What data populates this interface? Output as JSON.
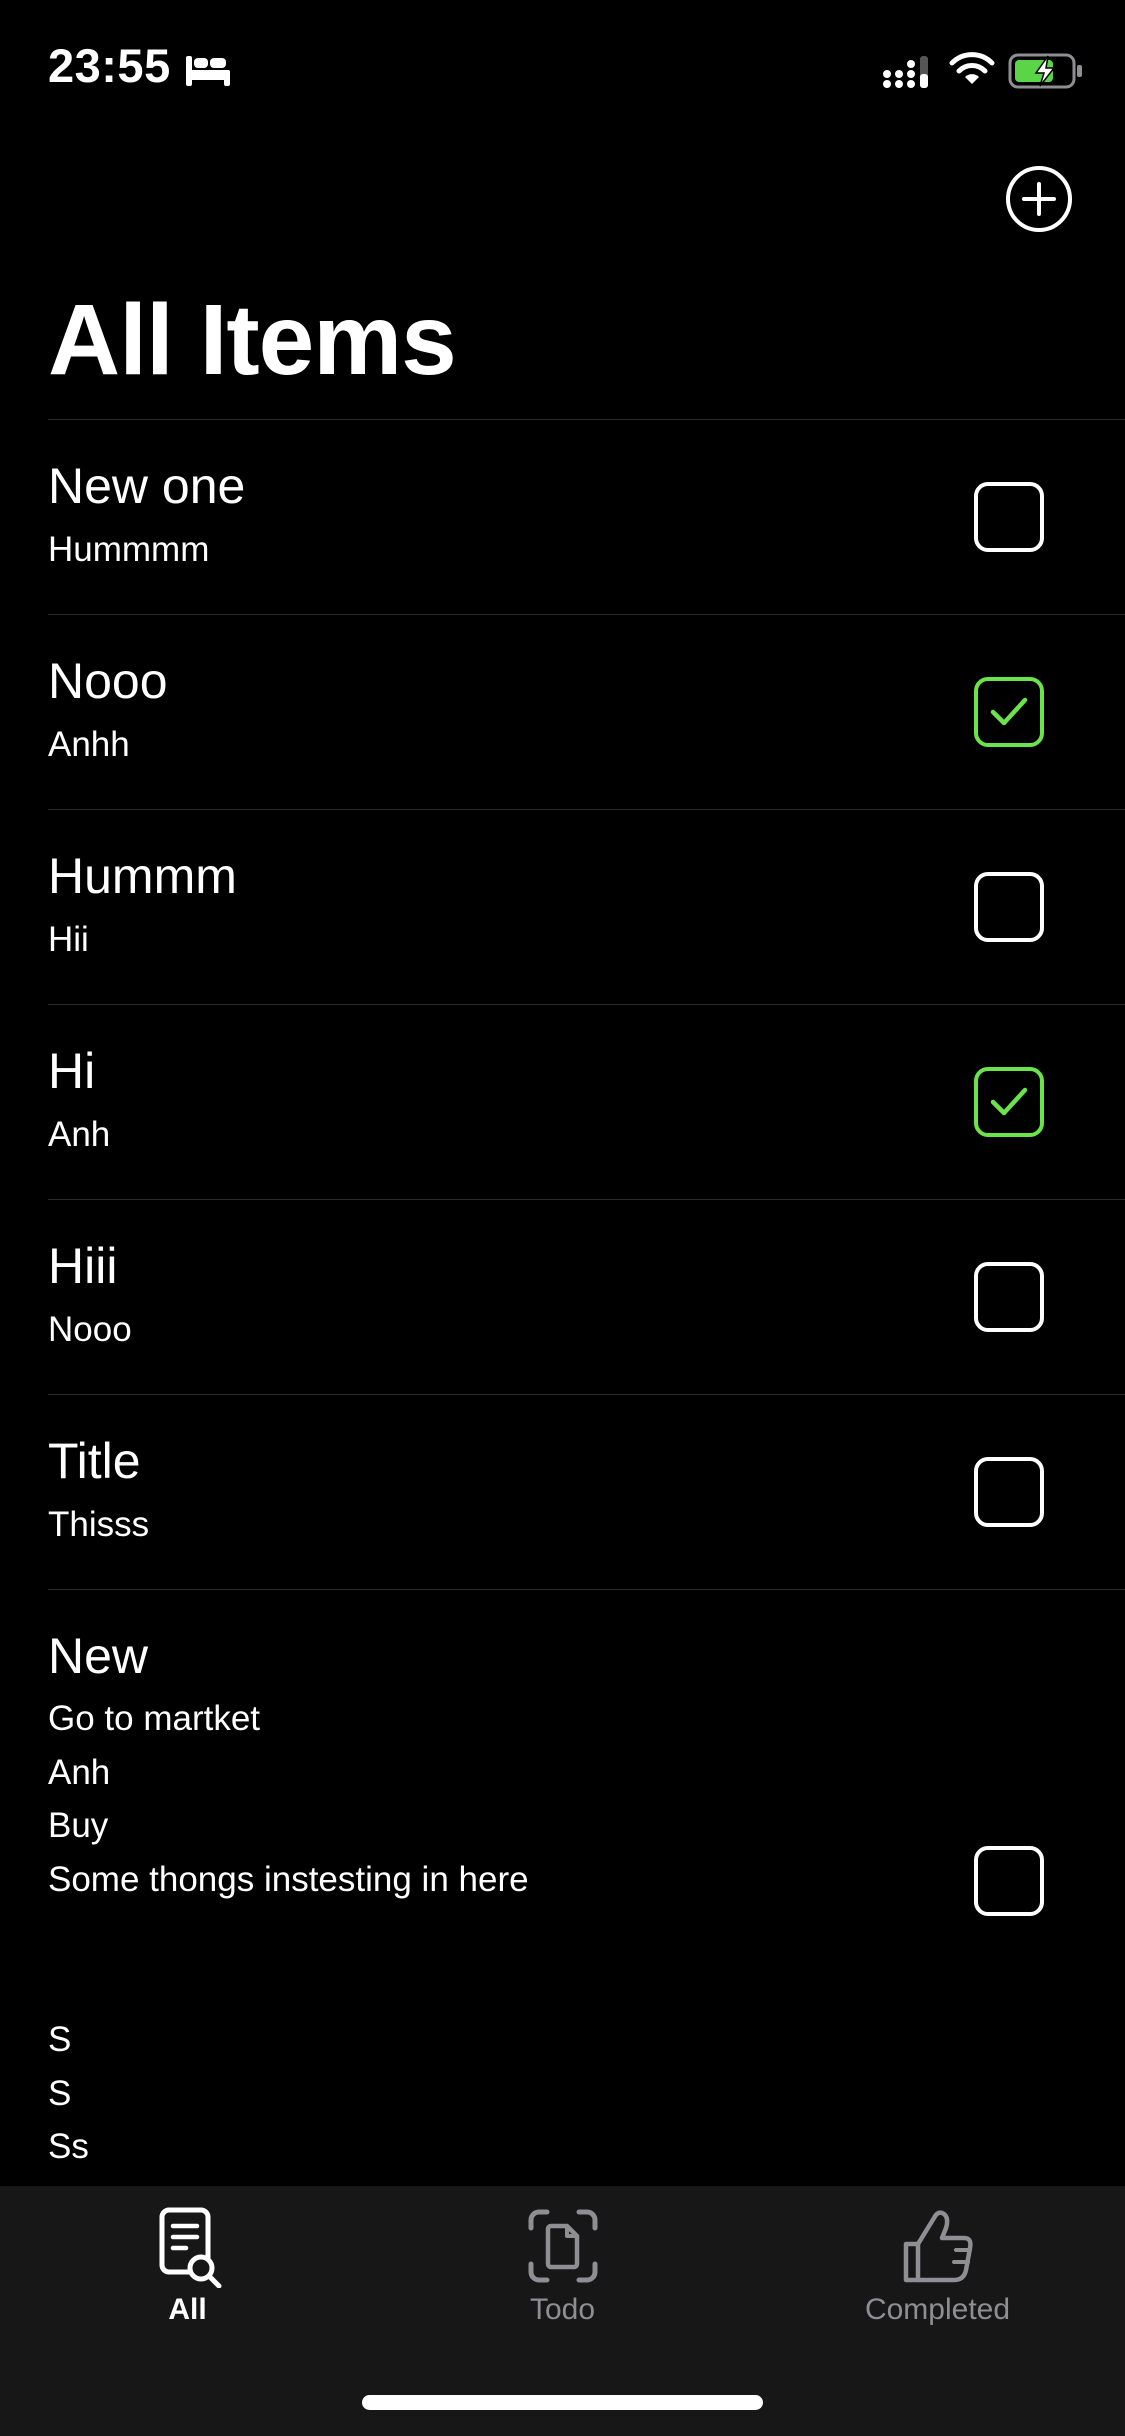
{
  "status_bar": {
    "time": "23:55",
    "icons": [
      "bed-icon",
      "signal-icon",
      "wifi-icon",
      "battery-charging-icon"
    ]
  },
  "nav": {
    "add_icon": "plus-circle-icon"
  },
  "title": "All Items",
  "items": [
    {
      "title": "New one",
      "subtitle": "Hummmm",
      "checked": false
    },
    {
      "title": "Nooo",
      "subtitle": "Anhh",
      "checked": true
    },
    {
      "title": "Hummm",
      "subtitle": "Hii",
      "checked": false
    },
    {
      "title": "Hi",
      "subtitle": "Anh",
      "checked": true
    },
    {
      "title": "Hiii",
      "subtitle": "Nooo",
      "checked": false
    },
    {
      "title": "Title",
      "subtitle": "Thisss",
      "checked": false
    },
    {
      "title": "New",
      "subtitle": "Go to martket\nAnh\nBuy\nSome thongs instesting in here\n\n\nS\nS\nSs",
      "checked": false
    }
  ],
  "tabs": [
    {
      "label": "All",
      "icon": "doc-search-icon",
      "active": true
    },
    {
      "label": "Todo",
      "icon": "doc-frame-icon",
      "active": false
    },
    {
      "label": "Completed",
      "icon": "thumbs-up-icon",
      "active": false
    }
  ],
  "colors": {
    "background": "#000000",
    "checked": "#6be34a",
    "tab_bar": "#171717",
    "inactive": "#8e8e93",
    "separator": "#2a2a2c"
  }
}
